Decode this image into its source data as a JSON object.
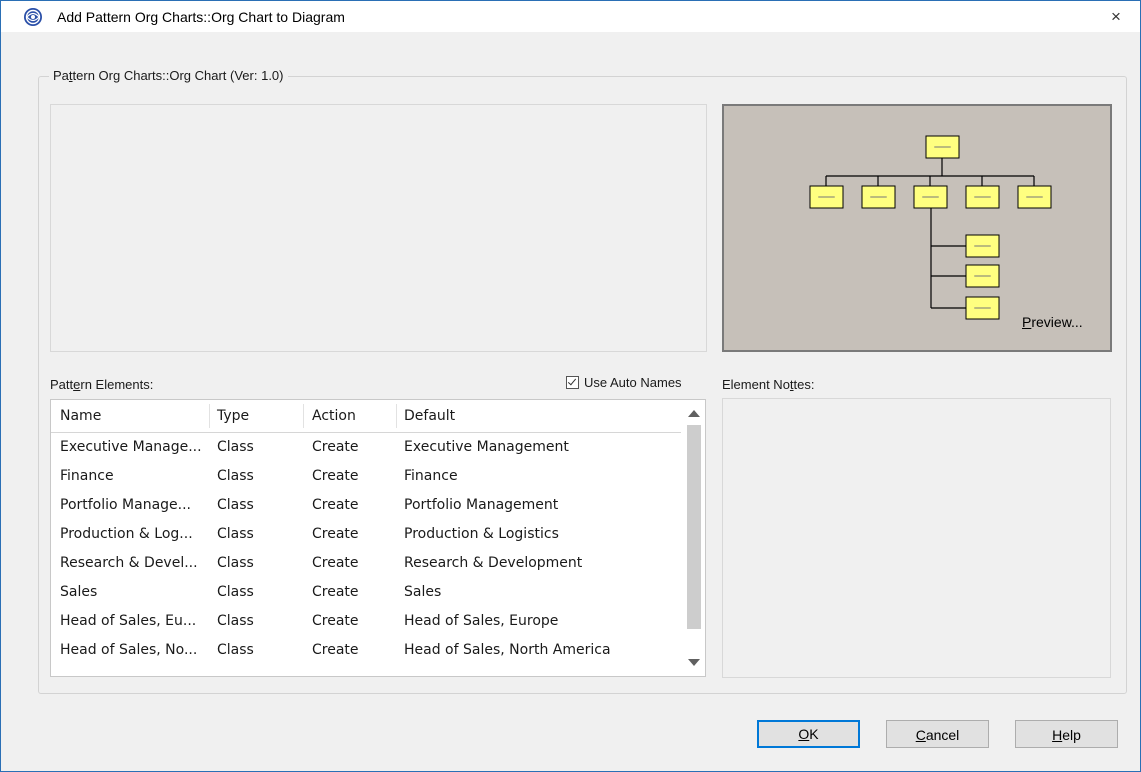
{
  "window": {
    "title": "Add Pattern Org Charts::Org Chart to Diagram",
    "close_glyph": "×"
  },
  "pattern_group": {
    "label": "Pattern Org Charts::Org Chart (Ver: 1.0)"
  },
  "preview": {
    "link_label": "Preview..."
  },
  "pattern_elements": {
    "label": "Pattern Elements:",
    "use_auto_names_label": "Use Auto Names",
    "use_auto_names_checked": true,
    "columns": [
      "Name",
      "Type",
      "Action",
      "Default"
    ],
    "rows": [
      {
        "name": "Executive Manage...",
        "type": "Class",
        "action": "Create",
        "default": "Executive Management"
      },
      {
        "name": "Finance",
        "type": "Class",
        "action": "Create",
        "default": "Finance"
      },
      {
        "name": "Portfolio Manage...",
        "type": "Class",
        "action": "Create",
        "default": "Portfolio Management"
      },
      {
        "name": "Production & Log...",
        "type": "Class",
        "action": "Create",
        "default": "Production & Logistics"
      },
      {
        "name": "Research & Devel...",
        "type": "Class",
        "action": "Create",
        "default": "Research & Development"
      },
      {
        "name": "Sales",
        "type": "Class",
        "action": "Create",
        "default": "Sales"
      },
      {
        "name": "Head of Sales, Eu...",
        "type": "Class",
        "action": "Create",
        "default": "Head of Sales, Europe"
      },
      {
        "name": "Head of Sales, No...",
        "type": "Class",
        "action": "Create",
        "default": "Head of Sales, North America"
      }
    ]
  },
  "element_notes": {
    "label": "Element Notes:"
  },
  "buttons": {
    "ok": "OK",
    "cancel": "Cancel",
    "help": "Help"
  },
  "colors": {
    "preview_bg": "#c6c0b9",
    "org_box": "#ffff80",
    "accent": "#0078d7"
  },
  "icons": {
    "app": "enterprise-architect-logo-icon",
    "close": "close-icon",
    "checkbox": "checkmark-icon"
  }
}
